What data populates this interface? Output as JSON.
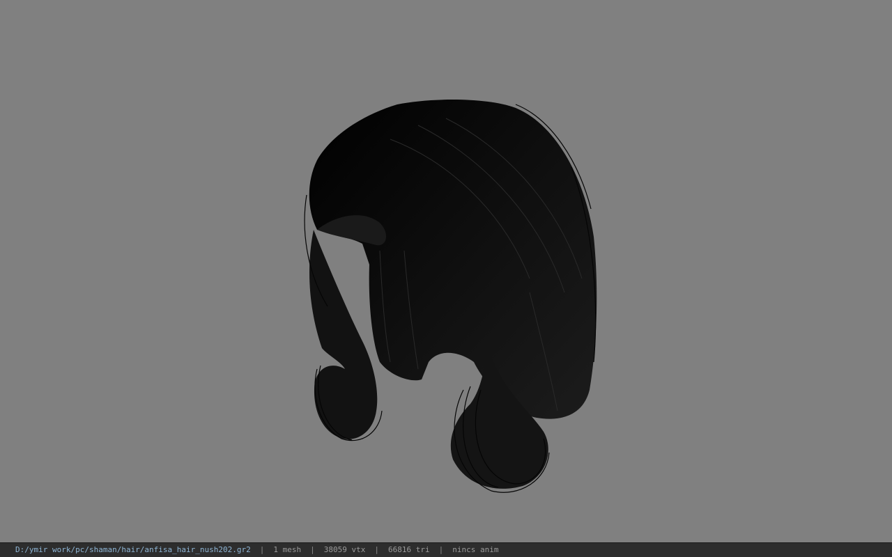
{
  "viewer": {
    "background_color": "#808080",
    "model": {
      "kind": "hair-mesh",
      "color": "#0b0b0b"
    }
  },
  "statusbar": {
    "file_path": "D:/ymir work/pc/shaman/hair/anfisa_hair_nush202.gr2",
    "mesh_count": "1 mesh",
    "vertex_count": "38059 vtx",
    "triangle_count": "66816 tri",
    "anim_status": "nincs anim",
    "separator": "|"
  }
}
